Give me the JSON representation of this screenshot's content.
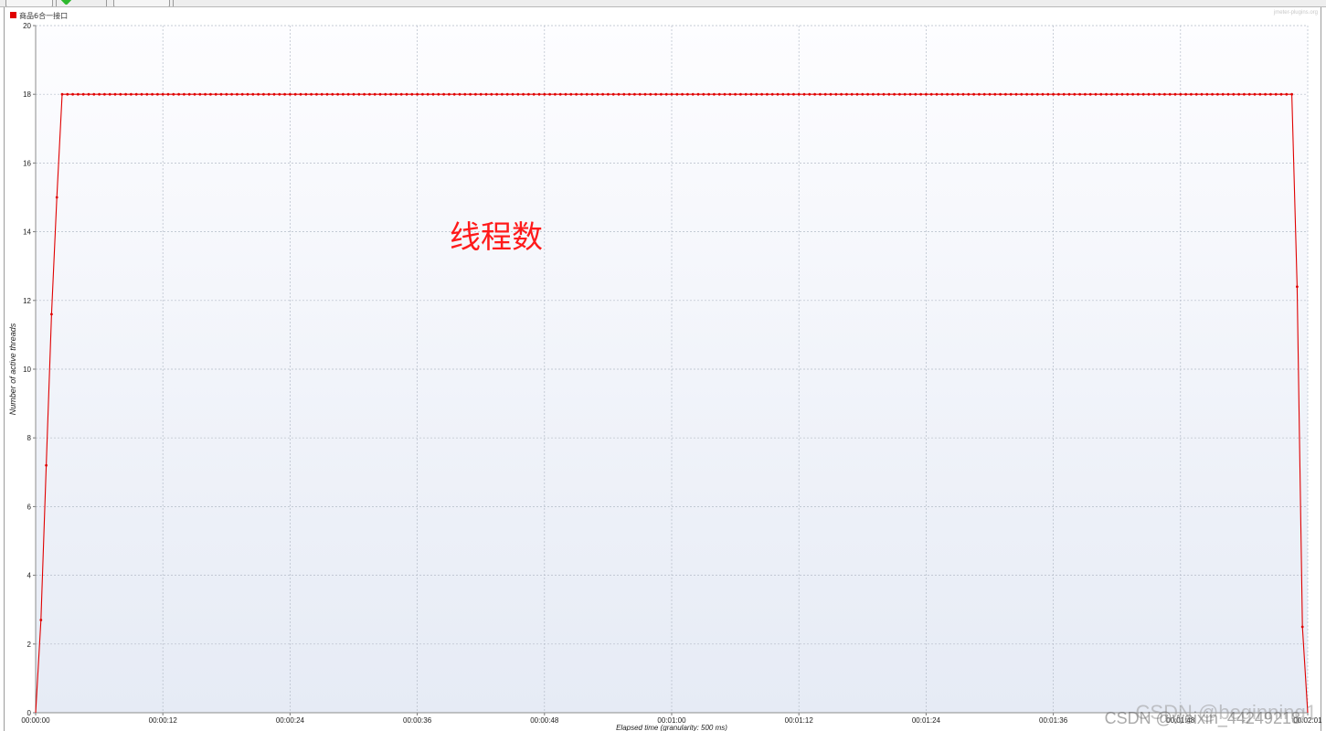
{
  "toolbar": {
    "buttons": [
      "",
      "",
      ""
    ]
  },
  "chart_data": {
    "type": "line",
    "title": "",
    "watermark_top": "jmeter-plugins.org",
    "xlabel": "Elapsed time (granularity: 500 ms)",
    "ylabel": "Number of active threads",
    "x_unit": "seconds",
    "xlim": [
      0,
      101
    ],
    "ylim": [
      0,
      20
    ],
    "yticks": [
      0,
      2,
      4,
      6,
      8,
      10,
      12,
      14,
      16,
      18,
      20
    ],
    "xticks": [
      {
        "t": 0,
        "label": "00:00:00"
      },
      {
        "t": 12,
        "label": "00:00:12"
      },
      {
        "t": 24,
        "label": "00:00:24"
      },
      {
        "t": 36,
        "label": "00:00:36"
      },
      {
        "t": 48,
        "label": "00:00:48"
      },
      {
        "t": 60,
        "label": "00:01:00"
      },
      {
        "t": 72,
        "label": "00:01:12"
      },
      {
        "t": 84,
        "label": "00:01:24"
      },
      {
        "t": 96,
        "label": "00:01:36"
      },
      {
        "t": 108,
        "label": "00:01:48"
      },
      {
        "t": 120,
        "label": "00:02:01"
      }
    ],
    "grid": true,
    "legend_position": "top-left",
    "series": [
      {
        "name": "商品6合一接口",
        "color": "#e00000",
        "plateau": {
          "from": 2.5,
          "to": 118.5,
          "step": 0.5,
          "value": 18
        },
        "ramp_up": [
          {
            "t": 0.0,
            "v": 0
          },
          {
            "t": 0.5,
            "v": 2.7
          },
          {
            "t": 1.0,
            "v": 7.2
          },
          {
            "t": 1.5,
            "v": 11.6
          },
          {
            "t": 2.0,
            "v": 15.0
          }
        ],
        "ramp_down": [
          {
            "t": 119.0,
            "v": 12.4
          },
          {
            "t": 119.5,
            "v": 2.5
          },
          {
            "t": 120.0,
            "v": 0
          }
        ]
      }
    ],
    "annotation": "线程数",
    "annotation_color": "#ff1a1a",
    "watermark": "CSDN @beginning1",
    "watermark2": "CSDN @weixin_44249218"
  }
}
